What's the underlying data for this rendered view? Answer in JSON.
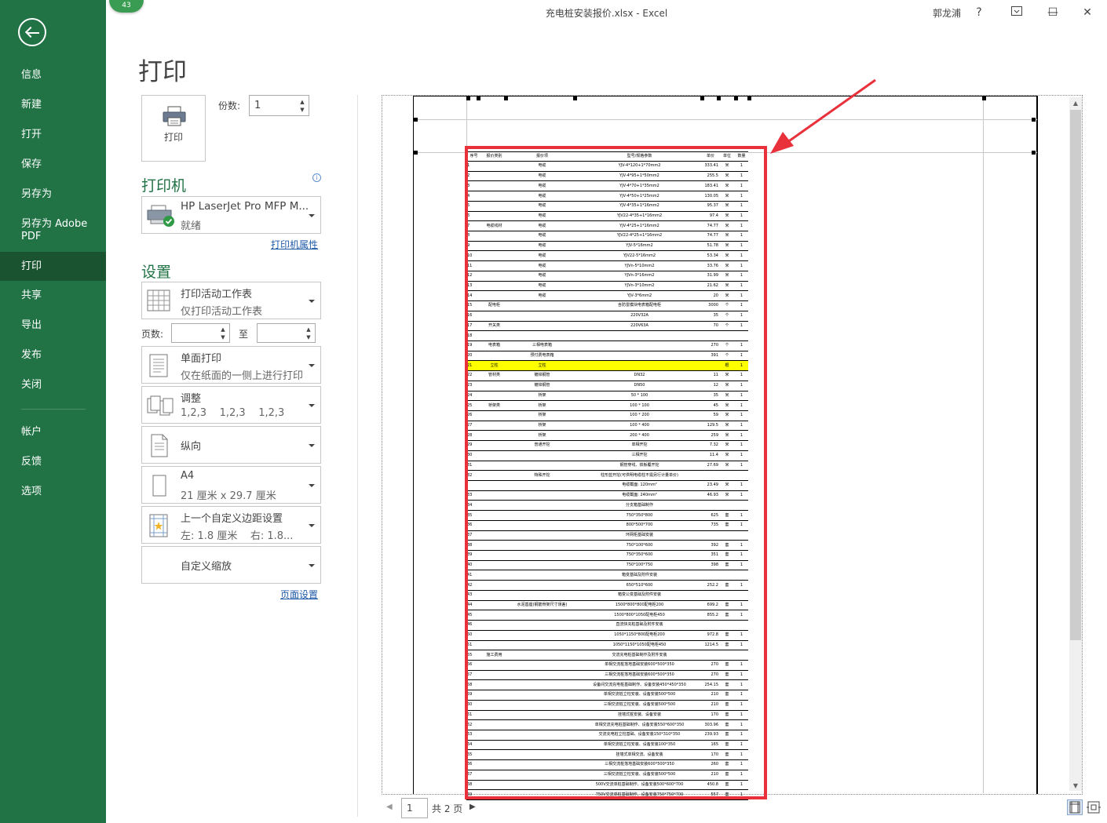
{
  "window": {
    "title": "充电桩安装报价.xlsx  -  Excel",
    "user": "郭龙浦",
    "help": "?",
    "minimize": "—",
    "maximize": "☐",
    "close": "✕",
    "badge": "43"
  },
  "backstage": {
    "items": [
      "信息",
      "新建",
      "打开",
      "保存",
      "另存为",
      "另存为 Adobe PDF",
      "打印",
      "共享",
      "导出",
      "发布",
      "关闭",
      "帐户",
      "反馈",
      "选项"
    ],
    "active": "打印"
  },
  "print": {
    "page_title": "打印",
    "print_button": "打印",
    "copies_label": "份数:",
    "copies_value": "1",
    "printer_heading": "打印机",
    "printer_name": "HP LaserJet Pro MFP M...",
    "printer_status": "就绪",
    "printer_props_link": "打印机属性",
    "settings_heading": "设置",
    "scope_main": "打印活动工作表",
    "scope_sub": "仅打印活动工作表",
    "pages_label": "页数:",
    "pages_to": "至",
    "sides_main": "单面打印",
    "sides_sub": "仅在纸面的一侧上进行打印",
    "collate_main": "调整",
    "collate_sub": "1,2,3    1,2,3    1,2,3",
    "orientation": "纵向",
    "paper_main": "A4",
    "paper_sub": "21 厘米 x 29.7 厘米",
    "margins_main": "上一个自定义边距设置",
    "margins_sub": "左: 1.8 厘米    右: 1.8...",
    "scaling": "自定义缩放",
    "page_setup_link": "页面设置"
  },
  "pager": {
    "current": "1",
    "total": "共 2 页"
  },
  "sheet": {
    "headers": [
      "序号",
      "报价类别",
      "报价项",
      "型号/规格参数",
      "单价",
      "单位",
      "数量"
    ],
    "rows": [
      [
        "1",
        "",
        "电缆",
        "YJV-4*120+1*70mm2",
        "333.41",
        "米",
        "1"
      ],
      [
        "2",
        "",
        "电缆",
        "YJV-4*95+1*50mm2",
        "255.5",
        "米",
        "1"
      ],
      [
        "3",
        "",
        "电缆",
        "YJV-4*70+1*35mm2",
        "183.41",
        "米",
        "1"
      ],
      [
        "4",
        "",
        "电缆",
        "YJV-4*50+1*25mm2",
        "130.05",
        "米",
        "1"
      ],
      [
        "5",
        "",
        "电缆",
        "YJV-4*35+1*16mm2",
        "95.37",
        "米",
        "1"
      ],
      [
        "6",
        "",
        "电缆",
        "YJV22-4*35+1*16mm2",
        "97.4",
        "米",
        "1"
      ],
      [
        "7",
        "电缆线材",
        "电缆",
        "YJV-4*25+1*16mm2",
        "74.77",
        "米",
        "1"
      ],
      [
        "8",
        "",
        "电缆",
        "YJV22-4*25+1*16mm2",
        "74.77",
        "米",
        "1"
      ],
      [
        "9",
        "",
        "电缆",
        "YJV-5*16mm2",
        "51.78",
        "米",
        "1"
      ],
      [
        "10",
        "",
        "电缆",
        "YJV22-5*16mm2",
        "53.34",
        "米",
        "1"
      ],
      [
        "11",
        "",
        "电缆",
        "YJVn-5*10mm2",
        "33.76",
        "米",
        "1"
      ],
      [
        "12",
        "",
        "电缆",
        "YJVn-3*16mm2",
        "31.99",
        "米",
        "1"
      ],
      [
        "13",
        "",
        "电缆",
        "YJVn-3*10mm2",
        "21.62",
        "米",
        "1"
      ],
      [
        "14",
        "",
        "电缆",
        "YJV-3*6mm2",
        "20",
        "米",
        "1"
      ],
      [
        "15",
        "配电柜",
        "",
        "含防雷模块电表箱配电柜",
        "3000",
        "个",
        "1"
      ],
      [
        "16",
        "",
        "",
        "220V32A",
        "35",
        "个",
        "1"
      ],
      [
        "17",
        "开关类",
        "",
        "220V63A",
        "70",
        "个",
        "1"
      ],
      [
        "18",
        "",
        "",
        "",
        "",
        "",
        ""
      ],
      [
        "19",
        "电表箱",
        "三相电表箱",
        "",
        "270",
        "个",
        "1"
      ],
      [
        "20",
        "",
        "预付费电表箱",
        "",
        "391",
        "个",
        "1"
      ],
      [
        "21",
        "立柱",
        "立柱",
        "",
        "",
        "根",
        "1"
      ],
      [
        "22",
        "管材类",
        "镀锌钢管",
        "DN32",
        "11",
        "米",
        "1"
      ],
      [
        "23",
        "",
        "镀锌钢管",
        "DN50",
        "12",
        "米",
        "1"
      ],
      [
        "24",
        "",
        "桥架",
        "50 * 100",
        "35",
        "米",
        "1"
      ],
      [
        "25",
        "桥架类",
        "桥架",
        "100 * 100",
        "45",
        "米",
        "1"
      ],
      [
        "26",
        "",
        "桥架",
        "100 * 200",
        "59",
        "米",
        "1"
      ],
      [
        "27",
        "",
        "桥架",
        "100 * 400",
        "129.5",
        "米",
        "1"
      ],
      [
        "28",
        "",
        "桥架",
        "200 * 400",
        "259",
        "米",
        "1"
      ],
      [
        "29",
        "",
        "普通开挖",
        "单相开挖",
        "7.32",
        "米",
        "1"
      ],
      [
        "30",
        "",
        "",
        "三相开挖",
        "11.4",
        "米",
        "1"
      ],
      [
        "31",
        "",
        "",
        "钢管穿线、铁板覆开挖",
        "27.69",
        "米",
        "1"
      ],
      [
        "32",
        "",
        "特殊开挖",
        "柱形蓝开挖(可供明电缆柱不需另行计量单价)",
        "",
        "",
        ""
      ],
      [
        "",
        "",
        "",
        "电缆截面: 120mm²",
        "23.49",
        "米",
        "1"
      ],
      [
        "33",
        "",
        "",
        "电缆截面: 240mm²",
        "46.93",
        "米",
        "1"
      ],
      [
        "34",
        "",
        "",
        "分支箱基础制作",
        "",
        "",
        ""
      ],
      [
        "35",
        "",
        "",
        "750*350*800",
        "625",
        "套",
        "1"
      ],
      [
        "36",
        "",
        "",
        "800*500*700",
        "735",
        "套",
        "1"
      ],
      [
        "37",
        "",
        "",
        "环网柜基础安装",
        "",
        "",
        ""
      ],
      [
        "38",
        "",
        "",
        "750*100*600",
        "392",
        "套",
        "1"
      ],
      [
        "39",
        "",
        "",
        "750*350*600",
        "351",
        "套",
        "1"
      ],
      [
        "40",
        "",
        "",
        "750*100*750",
        "398",
        "套",
        "1"
      ],
      [
        "41",
        "",
        "",
        "箱变基础及附件安装",
        "",
        "",
        ""
      ],
      [
        "42",
        "",
        "",
        "650*510*600",
        "252.2",
        "套",
        "1"
      ],
      [
        "43",
        "",
        "",
        "箱变公变基础及附件安装",
        "",
        "",
        ""
      ],
      [
        "44",
        "",
        "水泥基座(钢筋骨架尺寸误差)",
        "1500*800*800配电柜200",
        "699.2",
        "套",
        "1"
      ],
      [
        "45",
        "",
        "",
        "1500*800*1050配电柜450",
        "855.2",
        "套",
        "1"
      ],
      [
        "46",
        "",
        "",
        "直流快充桩基础及附件安装",
        "",
        "",
        ""
      ],
      [
        "50",
        "",
        "",
        "1050*1150*800配电柜200",
        "972.8",
        "套",
        "1"
      ],
      [
        "51",
        "",
        "",
        "1050*1150*1050配电柜450",
        "1214.5",
        "套",
        "1"
      ],
      [
        "55",
        "施工费用",
        "",
        "交流充电桩基础制作及附件安装",
        "",
        "",
        ""
      ],
      [
        "56",
        "",
        "",
        "单相交流桩落地基础安装600*500*350",
        "270",
        "套",
        "1"
      ],
      [
        "57",
        "",
        "",
        "三相交流桩落地基础安装600*500*350",
        "270",
        "套",
        "1"
      ],
      [
        "58",
        "",
        "",
        "设备间交流充电桩基础制作、设备安装450*450*350",
        "254.15",
        "套",
        "1"
      ],
      [
        "59",
        "",
        "",
        "单相交流桩立柱安装、设备安装500*500",
        "210",
        "套",
        "1"
      ],
      [
        "60",
        "",
        "",
        "三相交流桩立柱安装、设备安装500*500",
        "210",
        "套",
        "1"
      ],
      [
        "61",
        "",
        "",
        "挂墙式桩安装、设备安装",
        "170",
        "套",
        "1"
      ],
      [
        "62",
        "",
        "",
        "单相交流充电桩基础制作、设备安装550*600*350",
        "303.96",
        "套",
        "1"
      ],
      [
        "63",
        "",
        "",
        "交流充电桩立柱基础、设备安装150*310*350",
        "239.93",
        "套",
        "1"
      ],
      [
        "64",
        "",
        "",
        "单相交流桩立柱安装、设备安装100*350",
        "165",
        "套",
        "1"
      ],
      [
        "65",
        "",
        "",
        "挂墙式单相交流、设备安装",
        "170",
        "套",
        "1"
      ],
      [
        "66",
        "",
        "",
        "三相交流桩落地基础安装600*500*350",
        "260",
        "套",
        "1"
      ],
      [
        "67",
        "",
        "",
        "三相交流桩立柱安装、设备安装500*500",
        "210",
        "套",
        "1"
      ],
      [
        "68",
        "",
        "",
        "500V交流单桩基础制作、设备安装500*600*700",
        "450.8",
        "套",
        "1"
      ],
      [
        "69",
        "",
        "",
        "750V交流单桩基础制作、设备安装750*750*700",
        "557",
        "套",
        "1"
      ]
    ],
    "highlight_row": 20
  }
}
